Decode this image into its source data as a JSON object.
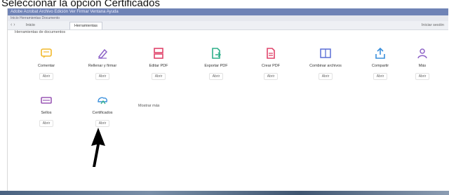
{
  "caption": "Seleccionar la opción Certificados",
  "window": {
    "menubar_text": "Adobe Acrobat  Archivo  Edición  Ver  Firmar  Ventana  Ayuda",
    "subbar_text": "Inicio   Herramientas   Documento",
    "tabs": [
      "Inicio",
      "Herramientas"
    ],
    "right_text": "Iniciar sesión",
    "breadcrumb": "Herramientas de documentos"
  },
  "tools": [
    {
      "name": "Comentar",
      "button": "Abrir",
      "icon": "comment-icon",
      "color": "#f2b92c"
    },
    {
      "name": "Rellenar y firmar",
      "button": "Abrir",
      "icon": "fill-sign-icon",
      "color": "#8e63c7"
    },
    {
      "name": "Editar PDF",
      "button": "Abrir",
      "icon": "edit-pdf-icon",
      "color": "#e0446a"
    },
    {
      "name": "Exportar PDF",
      "button": "Abrir",
      "icon": "export-pdf-icon",
      "color": "#2faf8a"
    },
    {
      "name": "Crear PDF",
      "button": "Abrir",
      "icon": "create-pdf-icon",
      "color": "#e0446a"
    },
    {
      "name": "Combinar archivos",
      "button": "Abrir",
      "icon": "combine-files-icon",
      "color": "#5b6fd6"
    },
    {
      "name": "Compartir",
      "button": "Abrir",
      "icon": "share-icon",
      "color": "#3a8fdc"
    },
    {
      "name": "Más",
      "button": "Abrir",
      "icon": "more-tools-icon",
      "color": "#8e63c7"
    },
    {
      "name": "Sellos",
      "button": "Abrir",
      "icon": "stamp-icon",
      "color": "#9b59b6"
    },
    {
      "name": "Certificados",
      "button": "Abrir",
      "icon": "certificates-icon",
      "color": "#3a8fdc"
    }
  ],
  "more_link": "Mostrar más"
}
